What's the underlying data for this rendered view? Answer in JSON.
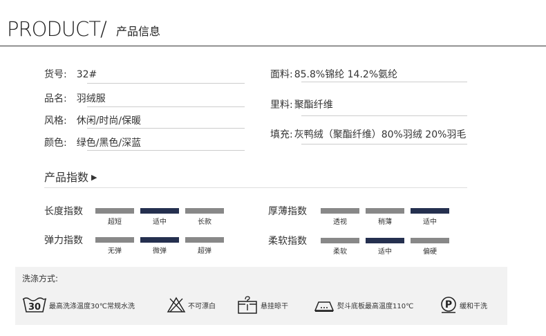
{
  "header": {
    "title": "PRODUCT/",
    "subtitle": "产品信息"
  },
  "info": {
    "left": [
      {
        "label": "货号:",
        "value": "32#"
      },
      {
        "label": "品名:",
        "value": "羽绒服"
      },
      {
        "label": "风格:",
        "value": "休闲/时尚/保暖"
      },
      {
        "label": "颜色:",
        "value": "绿色/黑色/深蓝"
      }
    ],
    "right": [
      {
        "label": "面料:",
        "value": "85.8%锦纶  14.2%氨纶"
      },
      {
        "label": "里料:",
        "value": "聚酯纤维"
      },
      {
        "label": "填充:",
        "value": "灰鸭绒（聚酯纤维）80%羽绒 20%羽毛"
      }
    ]
  },
  "index_section": {
    "title": "产品指数",
    "arrow": "▶",
    "indices": [
      {
        "label": "长度指数",
        "options": [
          "超短",
          "适中",
          "长款"
        ],
        "selected": 1
      },
      {
        "label": "厚薄指数",
        "options": [
          "透视",
          "稍薄",
          "适中"
        ],
        "selected": 2
      },
      {
        "label": "弹力指数",
        "options": [
          "无弹",
          "微弹",
          "超弹"
        ],
        "selected": 1
      },
      {
        "label": "柔软指数",
        "options": [
          "柔软",
          "适中",
          "偏硬"
        ],
        "selected": 1
      }
    ]
  },
  "washing": {
    "title": "洗涤方式:",
    "items": [
      {
        "icon": "wash-30-icon",
        "icon_text": "30",
        "text": "最高洗涤温度30℃常规水洗"
      },
      {
        "icon": "no-bleach-icon",
        "text": "不可漂白"
      },
      {
        "icon": "hang-dry-icon",
        "text": "悬挂晾干"
      },
      {
        "icon": "iron-icon",
        "text": "熨斗底板最高温度110℃"
      },
      {
        "icon": "dry-clean-icon",
        "icon_text": "P",
        "text": "缓和干洗"
      }
    ]
  },
  "colors": {
    "active_bar": "#25304f",
    "inactive_bar": "#888888",
    "wash_bg": "#f2f2f2"
  }
}
